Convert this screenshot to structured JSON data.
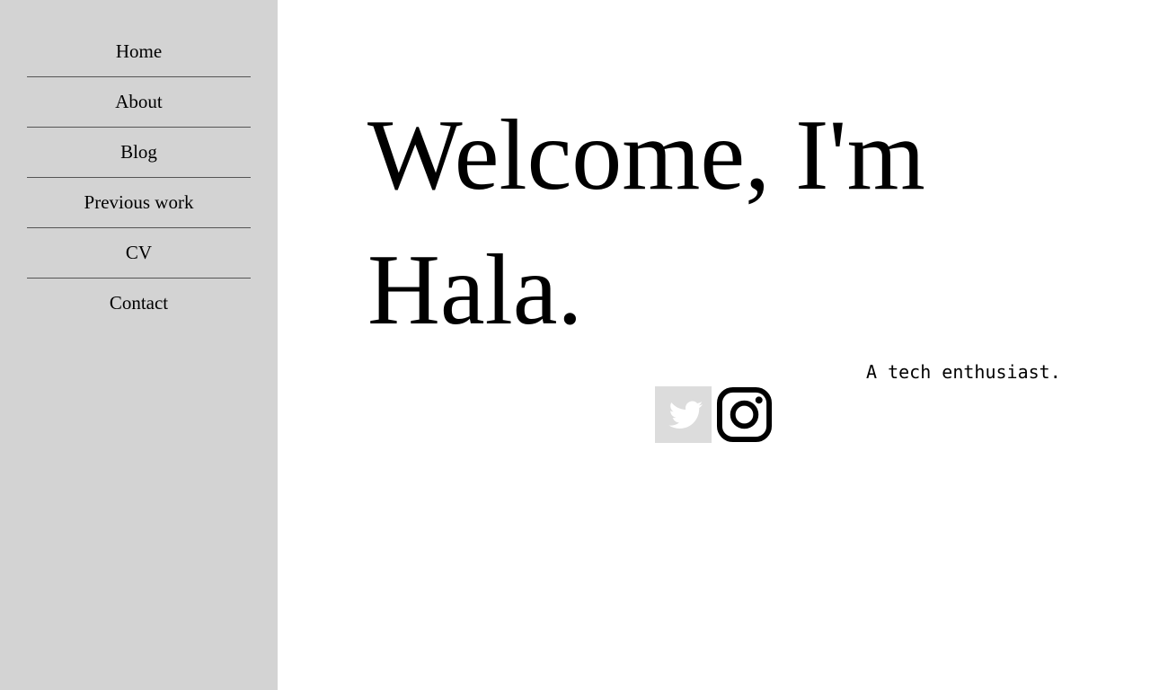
{
  "sidebar": {
    "items": [
      {
        "label": "Home"
      },
      {
        "label": "About"
      },
      {
        "label": "Blog"
      },
      {
        "label": "Previous work"
      },
      {
        "label": "CV"
      },
      {
        "label": "Contact"
      }
    ]
  },
  "hero": {
    "title": "Welcome, I'm Hala.",
    "tagline": "A tech enthusiast."
  },
  "social": {
    "icons": [
      "twitter-icon",
      "instagram-icon"
    ]
  },
  "colors": {
    "sidebar_bg": "#d3d3d3",
    "divider": "#555555",
    "twitter_tile_bg": "#dcdcdc",
    "text": "#000000"
  }
}
